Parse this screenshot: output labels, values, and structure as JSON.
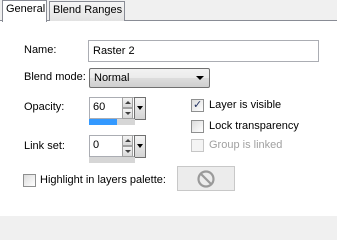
{
  "tabs": [
    {
      "label": "General"
    },
    {
      "label": "Blend Ranges"
    }
  ],
  "name": {
    "label": "Name:",
    "value": "Raster 2"
  },
  "blend_mode": {
    "label": "Blend mode:",
    "value": "Normal"
  },
  "opacity": {
    "label": "Opacity:",
    "value": "60",
    "level_percent": 60
  },
  "link_set": {
    "label": "Link set:",
    "value": "0"
  },
  "layer_visible": {
    "label": "Layer is visible",
    "checked": true
  },
  "lock_transparency": {
    "label": "Lock transparency",
    "checked": false
  },
  "group_linked": {
    "label": "Group is linked",
    "checked": false,
    "enabled": false
  },
  "highlight": {
    "label": "Highlight in layers palette:",
    "checked": false
  },
  "highlight_color_button": {
    "icon": "no-symbol-icon"
  },
  "colors": {
    "slider_fill": "#3399ff",
    "slider_track": "#d6d6d6",
    "disabled_text": "#a0a0a0",
    "no_symbol": "#9a9a9a"
  }
}
